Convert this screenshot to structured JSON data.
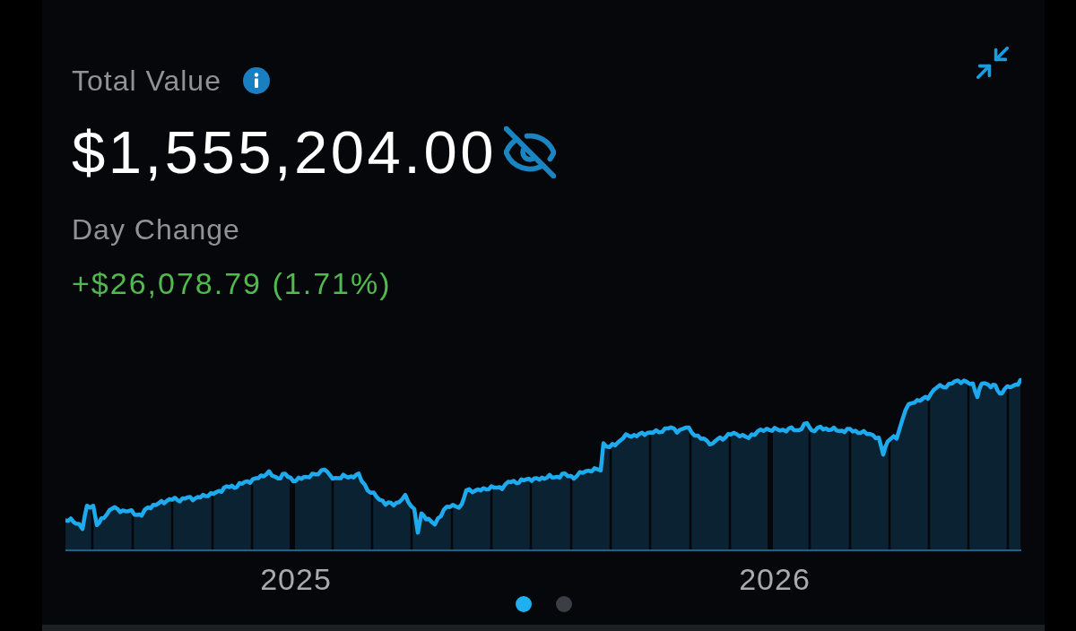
{
  "header": {
    "title": "Total Value"
  },
  "total": {
    "value": "$1,555,204.00"
  },
  "day_change": {
    "label": "Day Change",
    "value": "+$26,078.79 (1.71%)",
    "positive": true
  },
  "chart": {
    "x_labels": [
      "2025",
      "2026"
    ]
  },
  "pager": [
    {
      "selected": true
    },
    {
      "selected": false
    }
  ]
}
